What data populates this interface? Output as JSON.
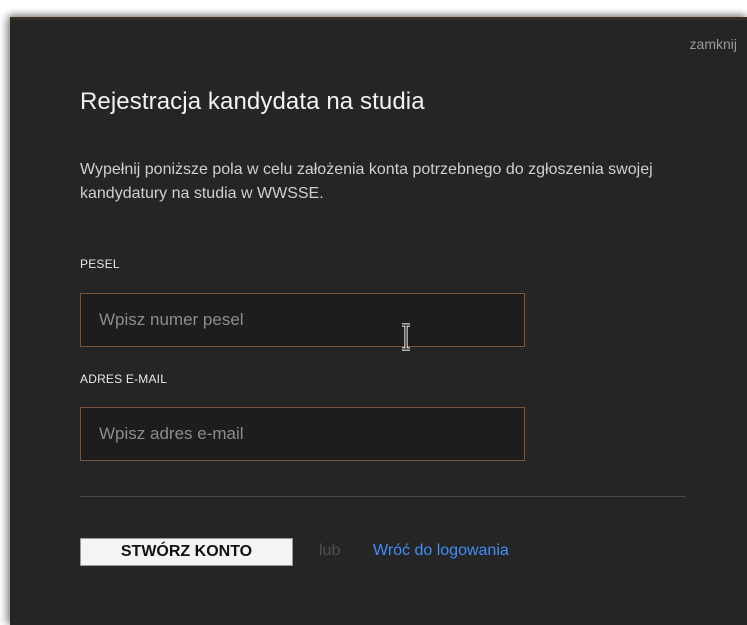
{
  "modal": {
    "close_label": "zamknij",
    "title": "Rejestracja kandydata na studia",
    "intro": "Wypełnij poniższe pola w celu założenia konta potrzebnego do zgłoszenia swojej kandydatury na studia w WWSSE.",
    "fields": {
      "pesel": {
        "label": "PESEL",
        "placeholder": "Wpisz numer pesel",
        "value": ""
      },
      "email": {
        "label": "ADRES E-MAIL",
        "placeholder": "Wpisz adres e-mail",
        "value": ""
      }
    },
    "actions": {
      "create_label": "STWÓRZ KONTO",
      "or_label": "lub",
      "back_label": "Wróć do logowania"
    }
  },
  "colors": {
    "modal_background": "#252525",
    "field_border": "#7a5438",
    "link": "#3f8ef7"
  },
  "icons": {
    "cursor": "text-cursor-icon"
  }
}
